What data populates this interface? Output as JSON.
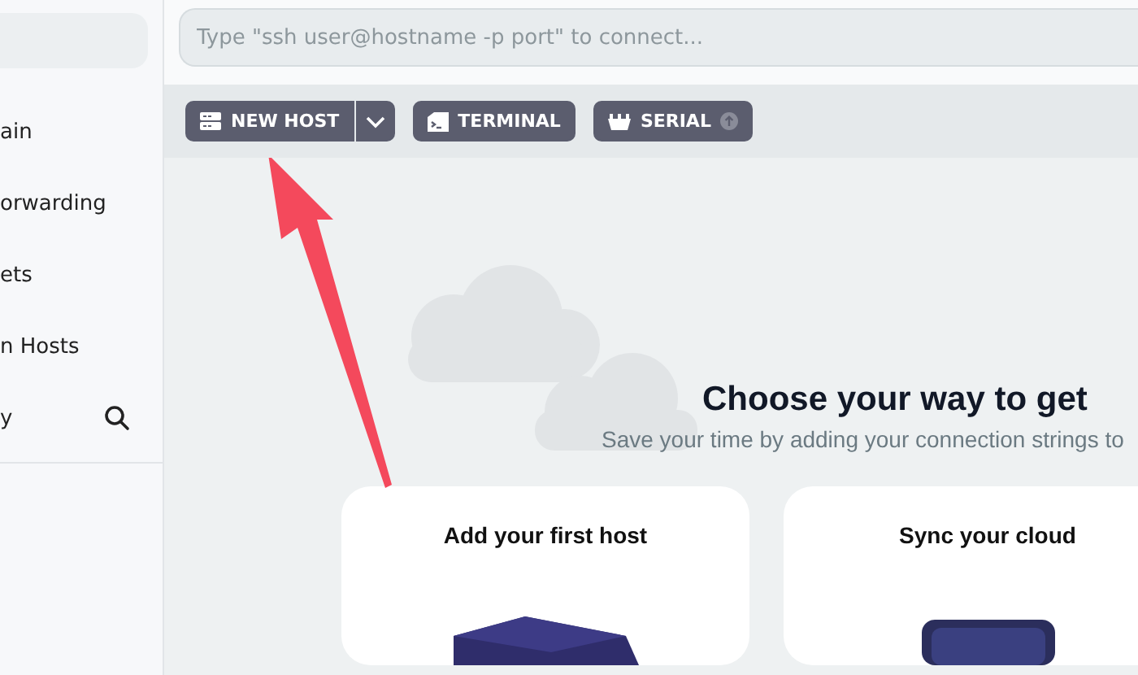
{
  "sidebar": {
    "items": [
      {
        "label": "ain"
      },
      {
        "label": "orwarding"
      },
      {
        "label": "ets"
      },
      {
        "label": "n Hosts"
      },
      {
        "label": "y",
        "search": true
      }
    ]
  },
  "search": {
    "placeholder": "Type \"ssh user@hostname -p port\" to connect..."
  },
  "toolbar": {
    "buttons": [
      {
        "kind": "new-host",
        "label": "NEW HOST",
        "dropdown": true
      },
      {
        "kind": "terminal",
        "label": "TERMINAL",
        "dropdown": false
      },
      {
        "kind": "serial",
        "label": "SERIAL",
        "dropdown": false
      }
    ]
  },
  "welcome": {
    "title": "Choose your way to get",
    "subtitle": "Save your time by adding your connection strings to"
  },
  "cards": [
    {
      "title": "Add your first host",
      "kind": "host"
    },
    {
      "title": "Sync your cloud",
      "kind": "cloud"
    }
  ]
}
